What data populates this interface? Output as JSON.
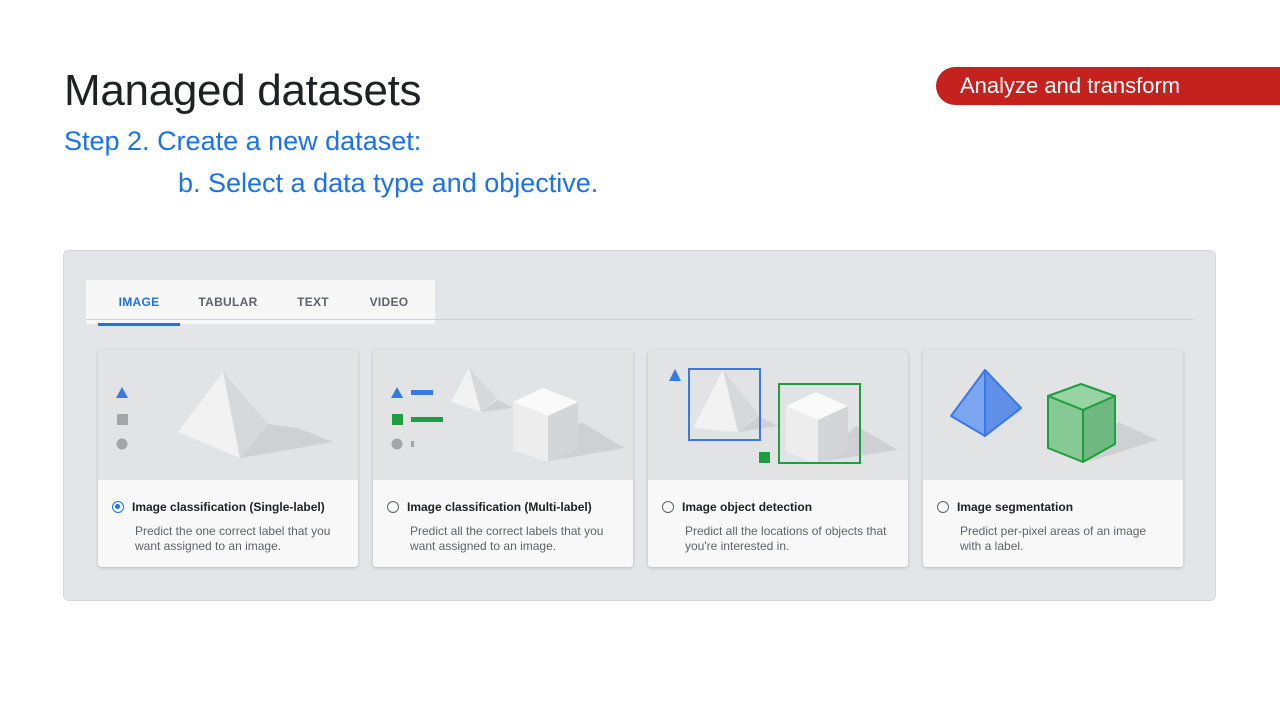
{
  "slide": {
    "title": "Managed datasets",
    "section_tag": "Analyze and transform",
    "step": "Step 2. Create a new dataset:",
    "sub_step": "b. Select a data type and objective."
  },
  "tabs": [
    {
      "label": "IMAGE",
      "active": true
    },
    {
      "label": "TABULAR",
      "active": false
    },
    {
      "label": "TEXT",
      "active": false
    },
    {
      "label": "VIDEO",
      "active": false
    }
  ],
  "cards": [
    {
      "title": "Image classification (Single-label)",
      "description": "Predict the one correct label that you want assigned to an image.",
      "selected": true
    },
    {
      "title": "Image classification (Multi-label)",
      "description": "Predict all the correct labels that you want assigned to an image.",
      "selected": false
    },
    {
      "title": "Image object detection",
      "description": "Predict all the locations of objects that you're interested in.",
      "selected": false
    },
    {
      "title": "Image segmentation",
      "description": "Predict per-pixel areas of an image with a label.",
      "selected": false
    }
  ],
  "colors": {
    "accent_blue": "#1a73e8",
    "section_red": "#c5221f",
    "marker_blue": "#3b78e7",
    "marker_green": "#1e9e3e",
    "segment_green": "#7cc48a"
  }
}
